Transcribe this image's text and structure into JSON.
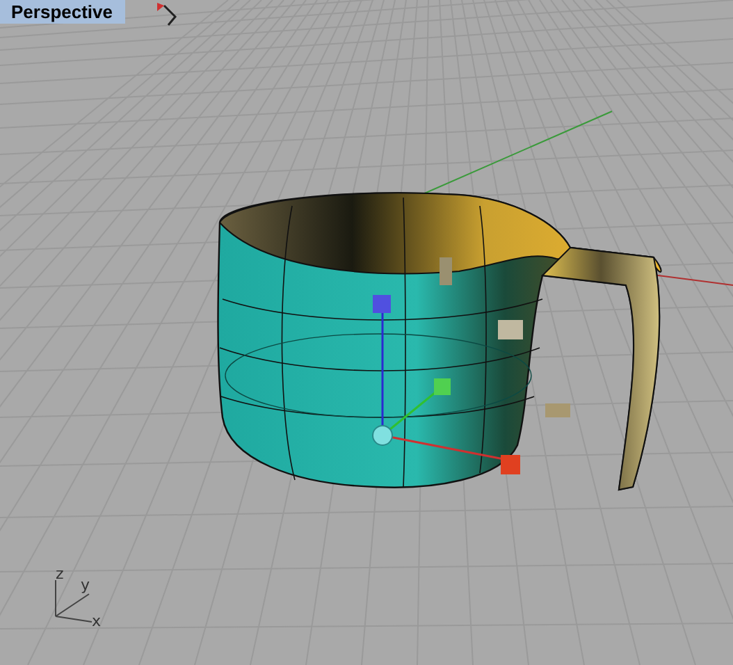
{
  "viewport": {
    "title": "Perspective"
  },
  "axis_labels": [
    "z",
    "y",
    "x"
  ]
}
